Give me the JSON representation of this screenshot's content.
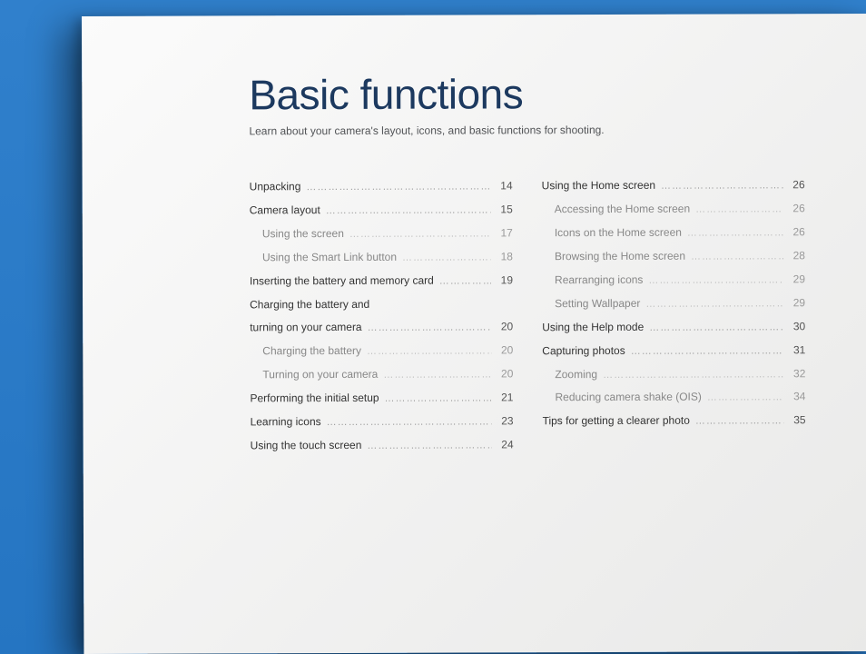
{
  "title": "Basic functions",
  "subtitle": "Learn about your camera's layout, icons, and basic functions for shooting.",
  "toc_left": [
    {
      "label": "Unpacking",
      "page": "14",
      "sub": false
    },
    {
      "label": "Camera layout",
      "page": "15",
      "sub": false
    },
    {
      "label": "Using the screen",
      "page": "17",
      "sub": true
    },
    {
      "label": "Using the Smart Link button",
      "page": "18",
      "sub": true
    },
    {
      "label": "Inserting the battery and memory card",
      "page": "19",
      "sub": false
    },
    {
      "label": "Charging the battery and turning on your camera",
      "page": "20",
      "sub": false,
      "wrap": 30
    },
    {
      "label": "Charging the battery",
      "page": "20",
      "sub": true
    },
    {
      "label": "Turning on your camera",
      "page": "20",
      "sub": true
    },
    {
      "label": "Performing the initial setup",
      "page": "21",
      "sub": false
    },
    {
      "label": "Learning icons",
      "page": "23",
      "sub": false
    },
    {
      "label": "Using the touch screen",
      "page": "24",
      "sub": false
    }
  ],
  "toc_right": [
    {
      "label": "Using the Home screen",
      "page": "26",
      "sub": false
    },
    {
      "label": "Accessing the Home screen",
      "page": "26",
      "sub": true
    },
    {
      "label": "Icons on the Home screen",
      "page": "26",
      "sub": true
    },
    {
      "label": "Browsing the Home screen",
      "page": "28",
      "sub": true
    },
    {
      "label": "Rearranging icons",
      "page": "29",
      "sub": true
    },
    {
      "label": "Setting Wallpaper",
      "page": "29",
      "sub": true
    },
    {
      "label": "Using the Help mode",
      "page": "30",
      "sub": false
    },
    {
      "label": "Capturing photos",
      "page": "31",
      "sub": false
    },
    {
      "label": "Zooming",
      "page": "32",
      "sub": true
    },
    {
      "label": "Reducing camera shake (OIS)",
      "page": "34",
      "sub": true
    },
    {
      "label": "Tips for getting a clearer photo",
      "page": "35",
      "sub": false
    }
  ]
}
